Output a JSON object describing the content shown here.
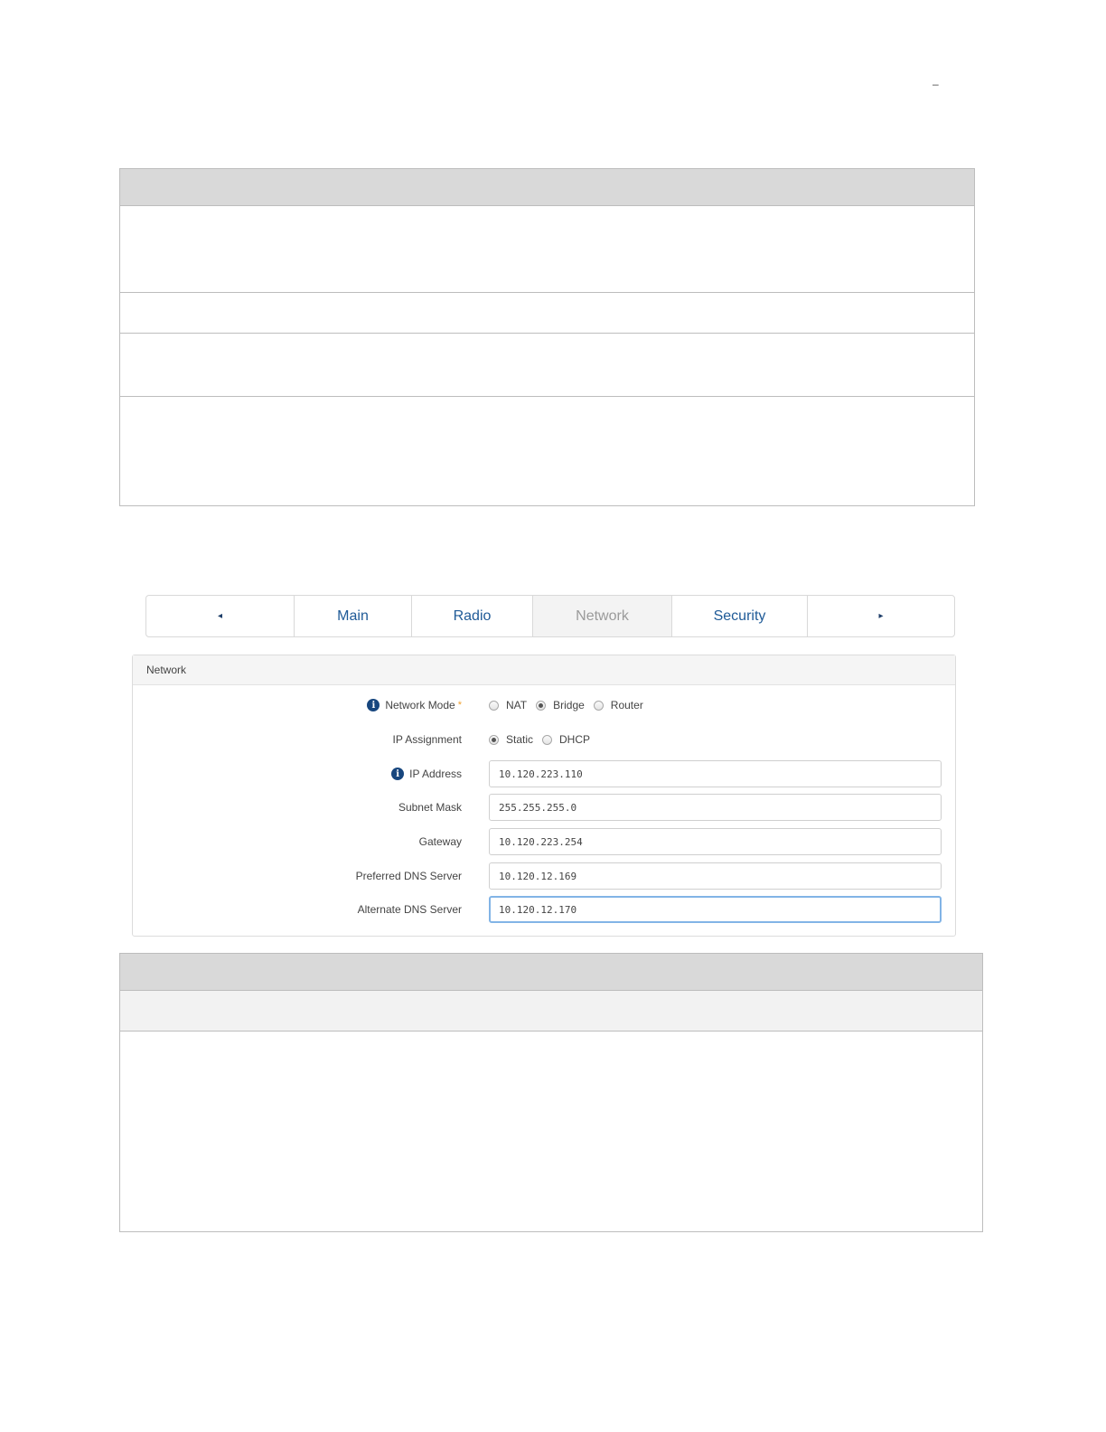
{
  "page": {
    "top_mark": "–"
  },
  "tabs": {
    "prev_icon": "◂",
    "items": [
      "Main",
      "Radio",
      "Network",
      "Security"
    ],
    "active": "Network",
    "next_icon": "▸"
  },
  "panel": {
    "title": "Network",
    "fields": {
      "network_mode": {
        "label": "Network Mode",
        "required_mark": "*",
        "options": [
          "NAT",
          "Bridge",
          "Router"
        ],
        "selected": "Bridge"
      },
      "ip_assignment": {
        "label": "IP Assignment",
        "options": [
          "Static",
          "DHCP"
        ],
        "selected": "Static"
      },
      "ip_address": {
        "label": "IP Address",
        "value": "10.120.223.110"
      },
      "subnet_mask": {
        "label": "Subnet Mask",
        "value": "255.255.255.0"
      },
      "gateway": {
        "label": "Gateway",
        "value": "10.120.223.254"
      },
      "preferred_dns": {
        "label": "Preferred DNS Server",
        "value": "10.120.12.169"
      },
      "alternate_dns": {
        "label": "Alternate DNS Server",
        "value": "10.120.12.170"
      }
    }
  },
  "icons": {
    "info": "info-icon",
    "prev": "triangle-left-icon",
    "next": "triangle-right-icon"
  },
  "colors": {
    "link_blue": "#1f5a97",
    "info_blue": "#17467e",
    "required_orange": "#f0a030",
    "focus_border": "#82b4e6"
  }
}
